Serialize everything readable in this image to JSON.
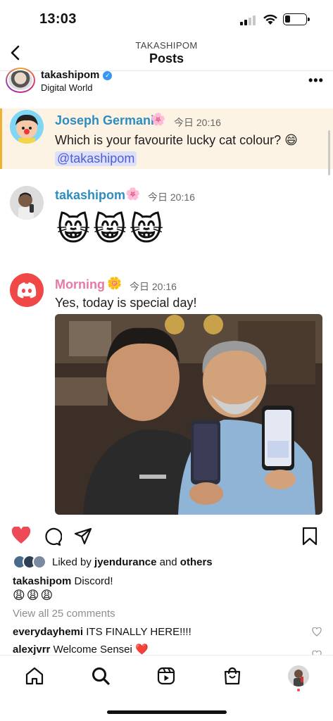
{
  "status_bar": {
    "time": "13:03"
  },
  "nav": {
    "account": "TAKASHIPOM",
    "title": "Posts"
  },
  "post": {
    "username": "takashipom",
    "location": "Digital World",
    "messages": [
      {
        "author": "Joseph Germani",
        "time": "今日 20:16",
        "text": "Which is your favourite lucky cat colour? 😄",
        "mention": "@takashipom",
        "author_color": "#2d8dbf"
      },
      {
        "author": "takashipom",
        "time": "今日 20:16",
        "text": "😸😸😸",
        "author_color": "#2d8dbf"
      },
      {
        "author": "Morning",
        "time": "今日 20:16",
        "text": "Yes, today is special day!",
        "author_color": "#e579a8"
      }
    ],
    "liked_by_user": "jyendurance",
    "liked_by_rest": "others",
    "liked_prefix": "Liked by",
    "liked_joiner": "and",
    "caption_user": "takashipom",
    "caption_text": "Discord!",
    "caption_emoji": "😩😩😩",
    "view_comments": "View all 25 comments",
    "comments": [
      {
        "user": "everydayhemi",
        "text": "ITS FINALLY HERE!!!!"
      },
      {
        "user": "alexjvrr",
        "text": "Welcome Sensei ❤️"
      }
    ]
  },
  "icons": {
    "back": "chevron-left-icon",
    "more": "more-horizontal-icon",
    "like": "heart-icon",
    "comment": "comment-icon",
    "share": "send-icon",
    "save": "bookmark-icon",
    "home": "home-icon",
    "search": "search-icon",
    "reels": "reels-icon",
    "shop": "shop-icon",
    "profile": "profile-avatar"
  },
  "colors": {
    "like_red": "#ed4956",
    "highlight_bg": "#fdf3e4",
    "highlight_bar": "#f0b232",
    "discord": "#f04747",
    "mention": "#4f5bd5"
  }
}
